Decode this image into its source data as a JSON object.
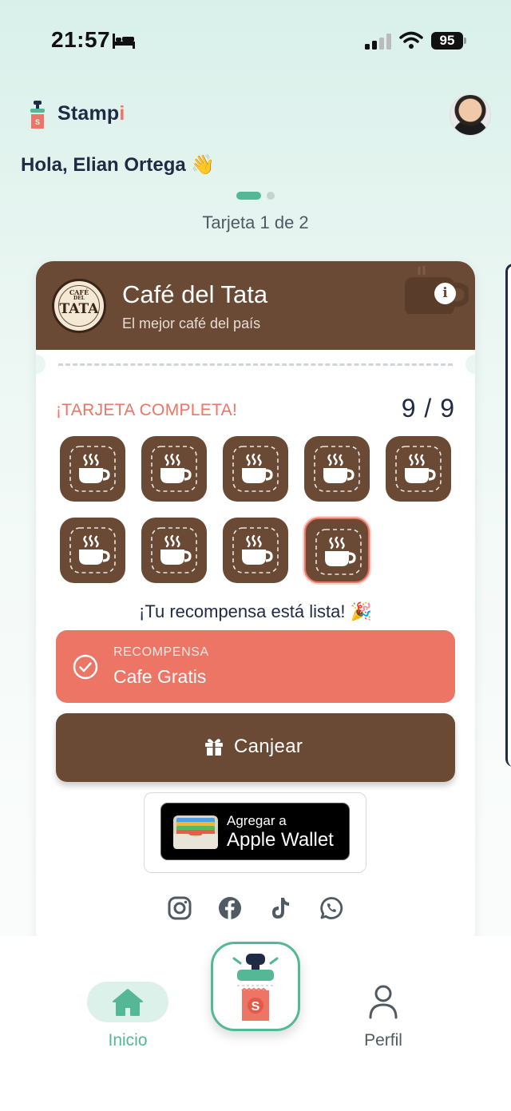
{
  "status_bar": {
    "time": "21:57",
    "battery": "95"
  },
  "app": {
    "name_main": "Stamp",
    "name_accent": "i"
  },
  "greeting": "Hola, Elian Ortega 👋",
  "carousel": {
    "counter": "Tarjeta 1 de 2",
    "current": 1,
    "total": 2
  },
  "card": {
    "business_name": "Café del Tata",
    "tagline": "El mejor café del país",
    "logo_text": {
      "line1": "CAFÉ",
      "line2": "DEL",
      "line3": "TATA"
    },
    "status_label": "¡TARJETA COMPLETA!",
    "stamp_count": "9 / 9",
    "stamps_filled": 9,
    "stamps_total": 9,
    "reward_ready_text": "¡Tu recompensa está lista! 🎉",
    "reward": {
      "caption": "RECOMPENSA",
      "name": "Cafe Gratis"
    },
    "redeem_label": "Canjear",
    "wallet": {
      "line1": "Agregar a",
      "line2": "Apple Wallet"
    },
    "socials": [
      "instagram-icon",
      "facebook-icon",
      "tiktok-icon",
      "whatsapp-icon"
    ]
  },
  "nav": {
    "home_label": "Inicio",
    "profile_label": "Perfil"
  },
  "colors": {
    "accent_green": "#54b896",
    "coral": "#ec7565",
    "brown": "#6b4a35",
    "navy": "#1f2a44"
  }
}
